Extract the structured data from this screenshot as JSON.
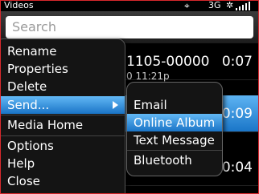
{
  "status": {
    "title": "Videos",
    "gps_glyph": "⌖",
    "network": "3G",
    "bluetooth_glyph": "✲"
  },
  "search": {
    "placeholder": "Search"
  },
  "videos": [
    {
      "name": "1105-00000",
      "date": "0 11:21p",
      "duration": "0:07"
    },
    {
      "name": "",
      "date": "",
      "duration": "0:09"
    },
    {
      "name": "",
      "date": "",
      "duration": "0:04"
    }
  ],
  "menu": {
    "items": [
      {
        "label": "Rename"
      },
      {
        "label": "Properties"
      },
      {
        "label": "Delete"
      },
      {
        "label": "Send..."
      },
      {
        "label": "Media Home"
      },
      {
        "label": "Options"
      },
      {
        "label": "Help"
      },
      {
        "label": "Close"
      }
    ],
    "highlighted": "Send..."
  },
  "submenu": {
    "items": [
      {
        "label": "Email"
      },
      {
        "label": "Online Album"
      },
      {
        "label": "Text Message"
      },
      {
        "label": "Bluetooth"
      }
    ],
    "highlighted": "Online Album"
  },
  "colors": {
    "highlight": "#1a74c6",
    "frame": "#d8282c"
  }
}
